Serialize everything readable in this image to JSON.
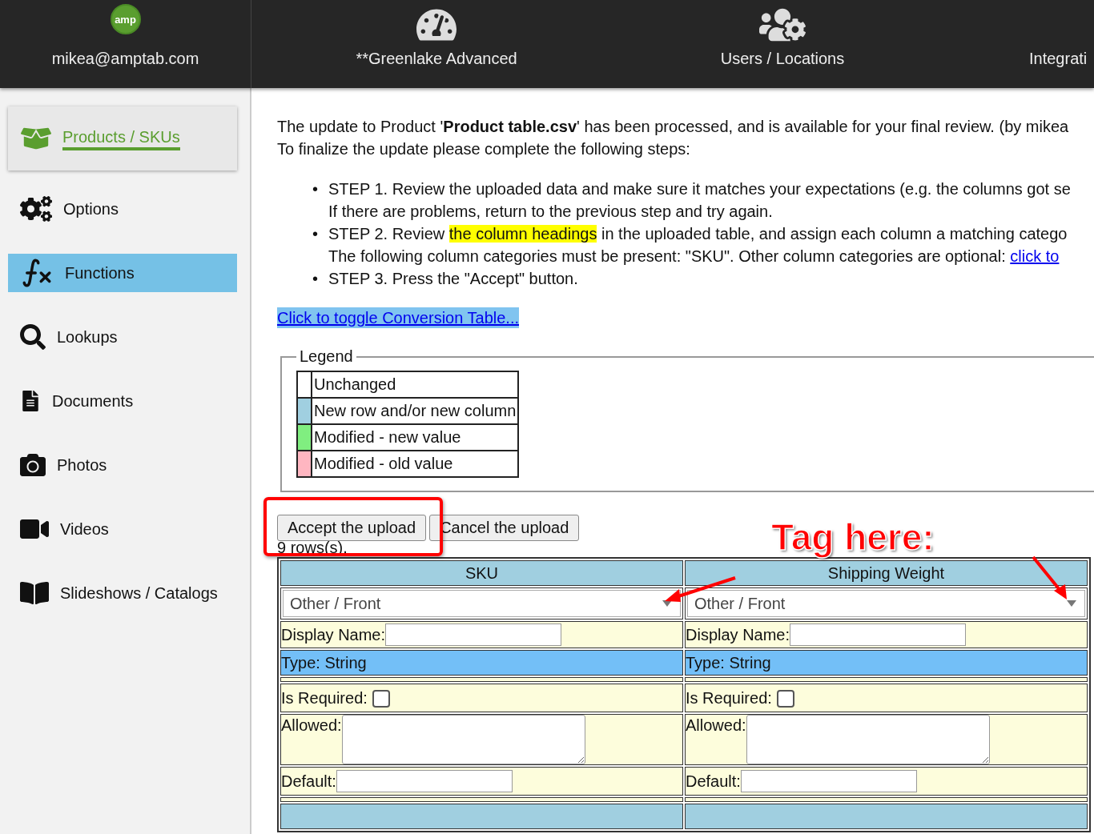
{
  "top_nav": {
    "logo": "amp",
    "items": [
      {
        "kind": "account",
        "label": "mikea@amptab.com"
      },
      {
        "kind": "gauge",
        "label": "**Greenlake Advanced"
      },
      {
        "kind": "users",
        "label": "Users / Locations"
      },
      {
        "kind": "none",
        "label": "Integrati"
      }
    ]
  },
  "sidebar": {
    "items": [
      {
        "label": "Products / SKUs",
        "active": true,
        "selected": false
      },
      {
        "label": "Options",
        "active": false,
        "selected": false
      },
      {
        "label": "Functions",
        "active": false,
        "selected": true
      },
      {
        "label": "Lookups",
        "active": false,
        "selected": false
      },
      {
        "label": "Documents",
        "active": false,
        "selected": false
      },
      {
        "label": "Photos",
        "active": false,
        "selected": false
      },
      {
        "label": "Videos",
        "active": false,
        "selected": false
      },
      {
        "label": "Slideshows / Catalogs",
        "active": false,
        "selected": false
      }
    ]
  },
  "intro": [
    "The update to Product '**Product table.csv**' has been processed, and is available for your final review. (by mikea",
    "To finalize the update please complete the following steps:"
  ],
  "bullet": "•",
  "steps": [
    {
      "lines": [
        {
          "before": "STEP 1. Review the uploaded data and make sure it matches your expectations (e.g. the columns got se"
        },
        {
          "before": "If there are problems, return to the previous step and try again."
        }
      ]
    },
    {
      "lines": [
        {
          "before": "STEP 2. Review",
          "highlight": "the column headings",
          "after": "in the uploaded table, and assign each column a matching catego"
        },
        {
          "before": "The following column categories must be present: \"SKU\". Other column categories are optional:",
          "link": "click to"
        }
      ]
    },
    {
      "lines": [
        {
          "before": "STEP 3. Press the \"Accept\" button."
        }
      ]
    }
  ],
  "toggle_link": "Click to toggle Conversion Table...",
  "legend": {
    "title": "Legend",
    "items": [
      {
        "label": "Unchanged",
        "color": "#ffffff"
      },
      {
        "label": "New row and/or new column",
        "color": "#a0cfe0"
      },
      {
        "label": "Modified - new value",
        "color": "#80ee80"
      },
      {
        "label": "Modified - old value",
        "color": "#ffb6c1"
      }
    ]
  },
  "buttons": [
    "Accept the upload",
    "Cancel the upload"
  ],
  "row_count": "9 rows(s).",
  "columns": [
    {
      "heading": "SKU",
      "category": "Other / Front",
      "display_name_label": "Display Name:",
      "type": "Type: String",
      "required_label": "Is Required:",
      "required": false,
      "allowed_label": "Allowed:",
      "default_label": "Default:"
    },
    {
      "heading": "Shipping Weight",
      "category": "Other / Front",
      "display_name_label": "Display Name:",
      "type": "Type: String",
      "required_label": "Is Required:",
      "required": false,
      "allowed_label": "Allowed:",
      "default_label": "Default:"
    }
  ],
  "annotation": {
    "text": "Tag here:"
  }
}
